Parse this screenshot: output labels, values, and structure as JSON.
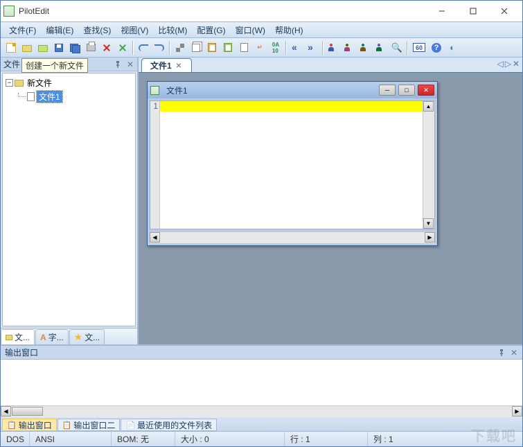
{
  "title": "PilotEdit",
  "menu": [
    "文件(F)",
    "编辑(E)",
    "查找(S)",
    "视图(V)",
    "比较(M)",
    "配置(G)",
    "窗口(W)",
    "帮助(H)"
  ],
  "sidebar": {
    "header": "文件",
    "tooltip": "创建一个新文件",
    "root_label": "新文件",
    "child_label": "文件1",
    "tabs": [
      "文...",
      "字...",
      "文..."
    ]
  },
  "doc_tab": "文件1",
  "mdi": {
    "title": "文件1",
    "line_no": "1"
  },
  "output": {
    "header": "输出窗口",
    "tabs": [
      "输出窗口",
      "输出窗口二",
      "最近使用的文件列表"
    ]
  },
  "status": {
    "mode": "DOS",
    "encoding": "ANSI",
    "bom": "BOM: 无",
    "size": "大小 : 0",
    "line": "行 : 1",
    "col": "列 : 1"
  },
  "toolbar_60": "60",
  "watermark": "下载吧"
}
